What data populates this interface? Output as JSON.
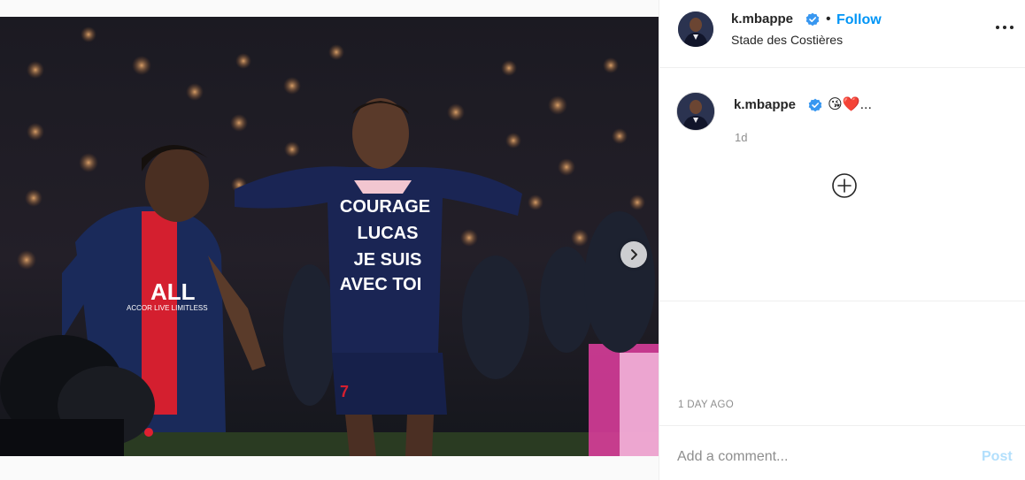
{
  "photo": {
    "alt_icon": "photo",
    "shirt_text": [
      "COURAGE",
      "LUCAS",
      "JE SUIS",
      "AVEC TOI"
    ],
    "jersey_sponsor": "ALL",
    "jersey_sponsor_sub": "ACCOR LIVE LIMITLESS",
    "shirt_number": "7",
    "carousel_next_icon": "chevron-right-icon"
  },
  "header": {
    "username": "k.mbappe",
    "verified_icon": "verified-badge-icon",
    "separator": "•",
    "follow_label": "Follow",
    "location": "Stade des Costières",
    "more_icon": "more-options-icon"
  },
  "caption": {
    "username": "k.mbappe",
    "verified_icon": "verified-badge-icon",
    "text": "😘❤️...",
    "time": "1d"
  },
  "load_more_icon": "add-circle-icon",
  "timestamp": "1 DAY AGO",
  "comment": {
    "placeholder": "Add a comment...",
    "post_label": "Post"
  },
  "colors": {
    "accent": "#0095f6",
    "accent_disabled": "#b2dffc",
    "secondary_text": "#8e8e8e",
    "border": "#efefef"
  }
}
